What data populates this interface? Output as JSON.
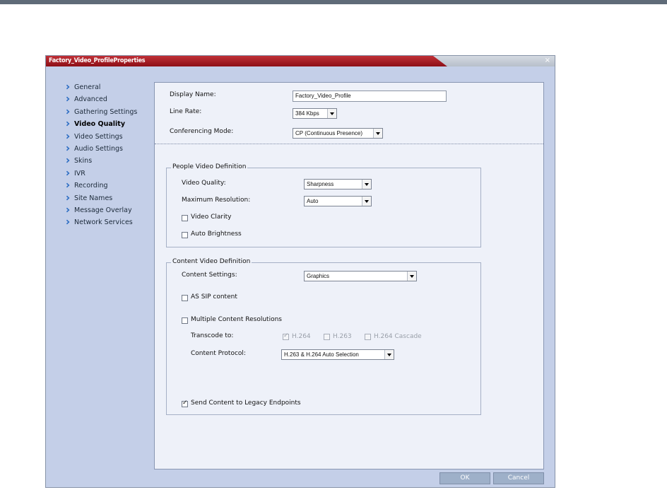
{
  "dialog": {
    "title": "Factory_Video_ProfileProperties",
    "close_glyph": "×"
  },
  "nav": {
    "items": [
      {
        "label": "General"
      },
      {
        "label": "Advanced"
      },
      {
        "label": "Gathering Settings"
      },
      {
        "label": "Video Quality",
        "active": true
      },
      {
        "label": "Video Settings"
      },
      {
        "label": "Audio Settings"
      },
      {
        "label": "Skins"
      },
      {
        "label": "IVR"
      },
      {
        "label": "Recording"
      },
      {
        "label": "Site Names"
      },
      {
        "label": "Message Overlay"
      },
      {
        "label": "Network Services"
      }
    ]
  },
  "form": {
    "display_name_label": "Display Name:",
    "display_name_value": "Factory_Video_Profile",
    "line_rate_label": "Line Rate:",
    "line_rate_value": "384 Kbps",
    "conferencing_mode_label": "Conferencing Mode:",
    "conferencing_mode_value": "CP (Continuous Presence)"
  },
  "people": {
    "legend": "People Video Definition",
    "video_quality_label": "Video Quality:",
    "video_quality_value": "Sharpness",
    "max_resolution_label": "Maximum Resolution:",
    "max_resolution_value": "Auto",
    "video_clarity_label": "Video Clarity",
    "video_clarity_checked": false,
    "auto_brightness_label": "Auto Brightness",
    "auto_brightness_checked": false
  },
  "content": {
    "legend": "Content Video Definition",
    "content_settings_label": "Content Settings:",
    "content_settings_value": "Graphics",
    "as_sip_label": "AS SIP content",
    "as_sip_checked": false,
    "multiple_resolutions_label": "Multiple Content Resolutions",
    "multiple_resolutions_checked": false,
    "transcode_label": "Transcode to:",
    "h264_label": "H.264",
    "h264_checked": true,
    "h263_label": "H.263",
    "h263_checked": false,
    "h264_cascade_label": "H.264 Cascade",
    "h264_cascade_checked": false,
    "content_protocol_label": "Content Protocol:",
    "content_protocol_value": "H.263 & H.264 Auto Selection",
    "send_legacy_label": "Send Content to Legacy Endpoints",
    "send_legacy_checked": true
  },
  "buttons": {
    "ok": "OK",
    "cancel": "Cancel"
  },
  "colors": {
    "titlebar_red": "#a81d24",
    "sidebar_bg": "#c4cfe8",
    "panel_bg": "#eef1f9",
    "nav_chevron": "#2f6fc4",
    "button_bg": "#9eb0c9"
  }
}
